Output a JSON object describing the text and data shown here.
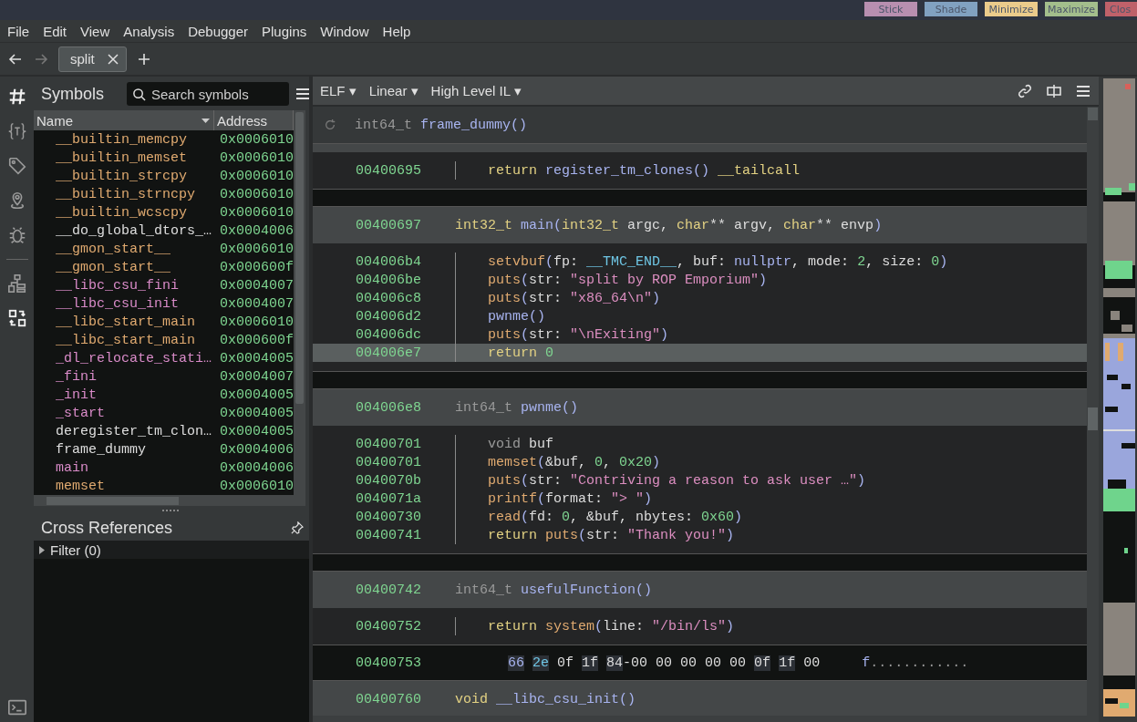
{
  "window_buttons": [
    {
      "label": "Stick",
      "color": "#b88fb0"
    },
    {
      "label": "Shade",
      "color": "#81a1c1"
    },
    {
      "label": "Minimize",
      "color": "#ebcb8b"
    },
    {
      "label": "Maximize",
      "color": "#a3be8c"
    },
    {
      "label": "Clos",
      "color": "#bf616a"
    }
  ],
  "menu": [
    "File",
    "Edit",
    "View",
    "Analysis",
    "Debugger",
    "Plugins",
    "Window",
    "Help"
  ],
  "nav": {
    "back_disabled": false,
    "forward_disabled": true
  },
  "tabs": [
    {
      "label": "split",
      "selected": true
    }
  ],
  "sidebar_icons": [
    {
      "kind": "hash",
      "selected": true
    },
    {
      "kind": "braces",
      "selected": false
    },
    {
      "kind": "tag",
      "selected": false
    },
    {
      "kind": "pin",
      "selected": false
    },
    {
      "kind": "bug",
      "selected": false
    },
    {
      "kind": "hierarchy",
      "selected": false
    },
    {
      "kind": "swap",
      "selected": true
    },
    {
      "kind": "terminal",
      "selected": false
    }
  ],
  "symbols": {
    "title": "Symbols",
    "search": {
      "placeholder": "Search symbols"
    },
    "columns": [
      "Name",
      "Address"
    ],
    "rows": [
      {
        "name": "__builtin_memcpy",
        "address": "0x0006010",
        "kind": "import"
      },
      {
        "name": "__builtin_memset",
        "address": "0x0006010",
        "kind": "import"
      },
      {
        "name": "__builtin_strcpy",
        "address": "0x0006010",
        "kind": "import"
      },
      {
        "name": "__builtin_strncpy",
        "address": "0x0006010",
        "kind": "import"
      },
      {
        "name": "__builtin_wcscpy",
        "address": "0x0006010",
        "kind": "import"
      },
      {
        "name": "__do_global_dtors_…",
        "address": "0x0004006",
        "kind": "local"
      },
      {
        "name": "__gmon_start__",
        "address": "0x0006010",
        "kind": "import"
      },
      {
        "name": "__gmon_start__",
        "address": "0x000600f",
        "kind": "import"
      },
      {
        "name": "__libc_csu_fini",
        "address": "0x0004007",
        "kind": "export"
      },
      {
        "name": "__libc_csu_init",
        "address": "0x0004007",
        "kind": "export"
      },
      {
        "name": "__libc_start_main",
        "address": "0x0006010",
        "kind": "import"
      },
      {
        "name": "__libc_start_main",
        "address": "0x000600f",
        "kind": "import"
      },
      {
        "name": "_dl_relocate_stati…",
        "address": "0x0004005",
        "kind": "export"
      },
      {
        "name": "_fini",
        "address": "0x0004007",
        "kind": "export"
      },
      {
        "name": "_init",
        "address": "0x0004005",
        "kind": "export"
      },
      {
        "name": "_start",
        "address": "0x0004005",
        "kind": "export"
      },
      {
        "name": "deregister_tm_clon…",
        "address": "0x0004005",
        "kind": "local"
      },
      {
        "name": "frame_dummy",
        "address": "0x0004006",
        "kind": "local"
      },
      {
        "name": "main",
        "address": "0x0004006",
        "kind": "export"
      },
      {
        "name": "memset",
        "address": "0x0006010",
        "kind": "import"
      }
    ]
  },
  "cross_references": {
    "title": "Cross References",
    "filter": "Filter (0)"
  },
  "view_toolbar": [
    "ELF ▾",
    "Linear ▾",
    "High Level IL ▾"
  ],
  "code_blocks": [
    {
      "kind": "sticky",
      "tokens": [
        {
          "text": "int64_t ",
          "kind": "dim"
        },
        {
          "text": "frame_dummy()",
          "kind": "func"
        }
      ]
    },
    {
      "kind": "stripe"
    },
    {
      "kind": "body",
      "lines": [
        {
          "address": "00400695",
          "highlighted": false,
          "tokens": [
            {
              "text": "return ",
              "kind": "kw"
            },
            {
              "text": "register_tm_clones() ",
              "kind": "func"
            },
            {
              "text": "__tailcall",
              "kind": "kw"
            }
          ]
        }
      ]
    },
    {
      "kind": "gap"
    },
    {
      "kind": "header",
      "address": "00400697",
      "tokens": [
        {
          "text": "int32_t ",
          "kind": "kw"
        },
        {
          "text": "main(",
          "kind": "func"
        },
        {
          "text": "int32_t ",
          "kind": "kw"
        },
        {
          "text": "argc, ",
          "kind": "plain"
        },
        {
          "text": "char",
          "kind": "kw"
        },
        {
          "text": "** argv, ",
          "kind": "plain"
        },
        {
          "text": "char",
          "kind": "kw"
        },
        {
          "text": "** envp",
          "kind": "plain"
        },
        {
          "text": ")",
          "kind": "func"
        }
      ]
    },
    {
      "kind": "body",
      "lines": [
        {
          "address": "004006b4",
          "highlighted": false,
          "tokens": [
            {
              "text": "setvbuf",
              "kind": "import"
            },
            {
              "text": "(",
              "kind": "func"
            },
            {
              "text": "fp: ",
              "kind": "plain"
            },
            {
              "text": "__TMC_END__",
              "kind": "data"
            },
            {
              "text": ", buf: ",
              "kind": "plain"
            },
            {
              "text": "nullptr",
              "kind": "func"
            },
            {
              "text": ", mode: ",
              "kind": "plain"
            },
            {
              "text": "2",
              "kind": "num"
            },
            {
              "text": ", size: ",
              "kind": "plain"
            },
            {
              "text": "0",
              "kind": "num"
            },
            {
              "text": ")",
              "kind": "func"
            }
          ]
        },
        {
          "address": "004006be",
          "highlighted": false,
          "tokens": [
            {
              "text": "puts",
              "kind": "import"
            },
            {
              "text": "(",
              "kind": "func"
            },
            {
              "text": "str: ",
              "kind": "plain"
            },
            {
              "text": "\"split by ROP Emporium\"",
              "kind": "str"
            },
            {
              "text": ")",
              "kind": "func"
            }
          ]
        },
        {
          "address": "004006c8",
          "highlighted": false,
          "tokens": [
            {
              "text": "puts",
              "kind": "import"
            },
            {
              "text": "(",
              "kind": "func"
            },
            {
              "text": "str: ",
              "kind": "plain"
            },
            {
              "text": "\"x86_64\\n\"",
              "kind": "str"
            },
            {
              "text": ")",
              "kind": "func"
            }
          ]
        },
        {
          "address": "004006d2",
          "highlighted": false,
          "tokens": [
            {
              "text": "pwnme()",
              "kind": "func"
            }
          ]
        },
        {
          "address": "004006dc",
          "highlighted": false,
          "tokens": [
            {
              "text": "puts",
              "kind": "import"
            },
            {
              "text": "(",
              "kind": "func"
            },
            {
              "text": "str: ",
              "kind": "plain"
            },
            {
              "text": "\"\\nExiting\"",
              "kind": "str"
            },
            {
              "text": ")",
              "kind": "func"
            }
          ]
        },
        {
          "address": "004006e7",
          "highlighted": true,
          "tokens": [
            {
              "text": "return ",
              "kind": "kw"
            },
            {
              "text": "0",
              "kind": "num"
            }
          ]
        }
      ]
    },
    {
      "kind": "gap"
    },
    {
      "kind": "header",
      "address": "004006e8",
      "tokens": [
        {
          "text": "int64_t ",
          "kind": "dim"
        },
        {
          "text": "pwnme()",
          "kind": "func"
        }
      ]
    },
    {
      "kind": "body",
      "lines": [
        {
          "address": "00400701",
          "highlighted": false,
          "tokens": [
            {
              "text": "void ",
              "kind": "dim"
            },
            {
              "text": "buf",
              "kind": "plain"
            }
          ]
        },
        {
          "address": "00400701",
          "highlighted": false,
          "tokens": [
            {
              "text": "memset",
              "kind": "import"
            },
            {
              "text": "(",
              "kind": "func"
            },
            {
              "text": "&buf, ",
              "kind": "plain"
            },
            {
              "text": "0",
              "kind": "num"
            },
            {
              "text": ", ",
              "kind": "plain"
            },
            {
              "text": "0x20",
              "kind": "num"
            },
            {
              "text": ")",
              "kind": "func"
            }
          ]
        },
        {
          "address": "0040070b",
          "highlighted": false,
          "tokens": [
            {
              "text": "puts",
              "kind": "import"
            },
            {
              "text": "(",
              "kind": "func"
            },
            {
              "text": "str: ",
              "kind": "plain"
            },
            {
              "text": "\"Contriving a reason to ask user …\"",
              "kind": "str"
            },
            {
              "text": ")",
              "kind": "func"
            }
          ]
        },
        {
          "address": "0040071a",
          "highlighted": false,
          "tokens": [
            {
              "text": "printf",
              "kind": "import"
            },
            {
              "text": "(",
              "kind": "func"
            },
            {
              "text": "format: ",
              "kind": "plain"
            },
            {
              "text": "\"> \"",
              "kind": "str"
            },
            {
              "text": ")",
              "kind": "func"
            }
          ]
        },
        {
          "address": "00400730",
          "highlighted": false,
          "tokens": [
            {
              "text": "read",
              "kind": "import"
            },
            {
              "text": "(",
              "kind": "func"
            },
            {
              "text": "fd: ",
              "kind": "plain"
            },
            {
              "text": "0",
              "kind": "num"
            },
            {
              "text": ", &buf, nbytes: ",
              "kind": "plain"
            },
            {
              "text": "0x60",
              "kind": "num"
            },
            {
              "text": ")",
              "kind": "func"
            }
          ]
        },
        {
          "address": "00400741",
          "highlighted": false,
          "tokens": [
            {
              "text": "return ",
              "kind": "kw"
            },
            {
              "text": "puts",
              "kind": "import"
            },
            {
              "text": "(",
              "kind": "func"
            },
            {
              "text": "str: ",
              "kind": "plain"
            },
            {
              "text": "\"Thank you!\"",
              "kind": "str"
            },
            {
              "text": ")",
              "kind": "func"
            }
          ]
        }
      ]
    },
    {
      "kind": "gap"
    },
    {
      "kind": "header",
      "address": "00400742",
      "tokens": [
        {
          "text": "int64_t ",
          "kind": "dim"
        },
        {
          "text": "usefulFunction()",
          "kind": "func"
        }
      ]
    },
    {
      "kind": "body",
      "lines": [
        {
          "address": "00400752",
          "highlighted": false,
          "tokens": [
            {
              "text": "return ",
              "kind": "kw"
            },
            {
              "text": "system",
              "kind": "import"
            },
            {
              "text": "(",
              "kind": "func"
            },
            {
              "text": "line: ",
              "kind": "plain"
            },
            {
              "text": "\"/bin/ls\"",
              "kind": "str"
            },
            {
              "text": ")",
              "kind": "func"
            }
          ]
        }
      ]
    },
    {
      "kind": "hex",
      "address": "00400753",
      "bytes": [
        {
          "text": "66",
          "kind": "func",
          "boxed": true,
          "attached": false
        },
        {
          "text": "2e",
          "kind": "data",
          "boxed": true,
          "attached": false
        },
        {
          "text": "0f",
          "kind": "plain",
          "boxed": false,
          "attached": false
        },
        {
          "text": "1f",
          "kind": "plain",
          "boxed": true,
          "attached": false
        },
        {
          "text": "84",
          "kind": "plain",
          "boxed": true,
          "attached": false
        },
        {
          "text": "-00 00 00 00 00",
          "kind": "plain",
          "boxed": false,
          "attached": true
        },
        {
          "text": "0f",
          "kind": "plain",
          "boxed": true,
          "attached": false
        },
        {
          "text": "1f",
          "kind": "plain",
          "boxed": true,
          "attached": false
        },
        {
          "text": "00",
          "kind": "plain",
          "boxed": false,
          "attached": false
        }
      ],
      "ascii": [
        {
          "text": "f",
          "kind": "func"
        },
        {
          "text": "............",
          "kind": "dim"
        }
      ]
    },
    {
      "kind": "header",
      "address": "00400760",
      "tokens": [
        {
          "text": "void ",
          "kind": "kw"
        },
        {
          "text": "__libc_csu_init()",
          "kind": "func"
        }
      ]
    }
  ]
}
